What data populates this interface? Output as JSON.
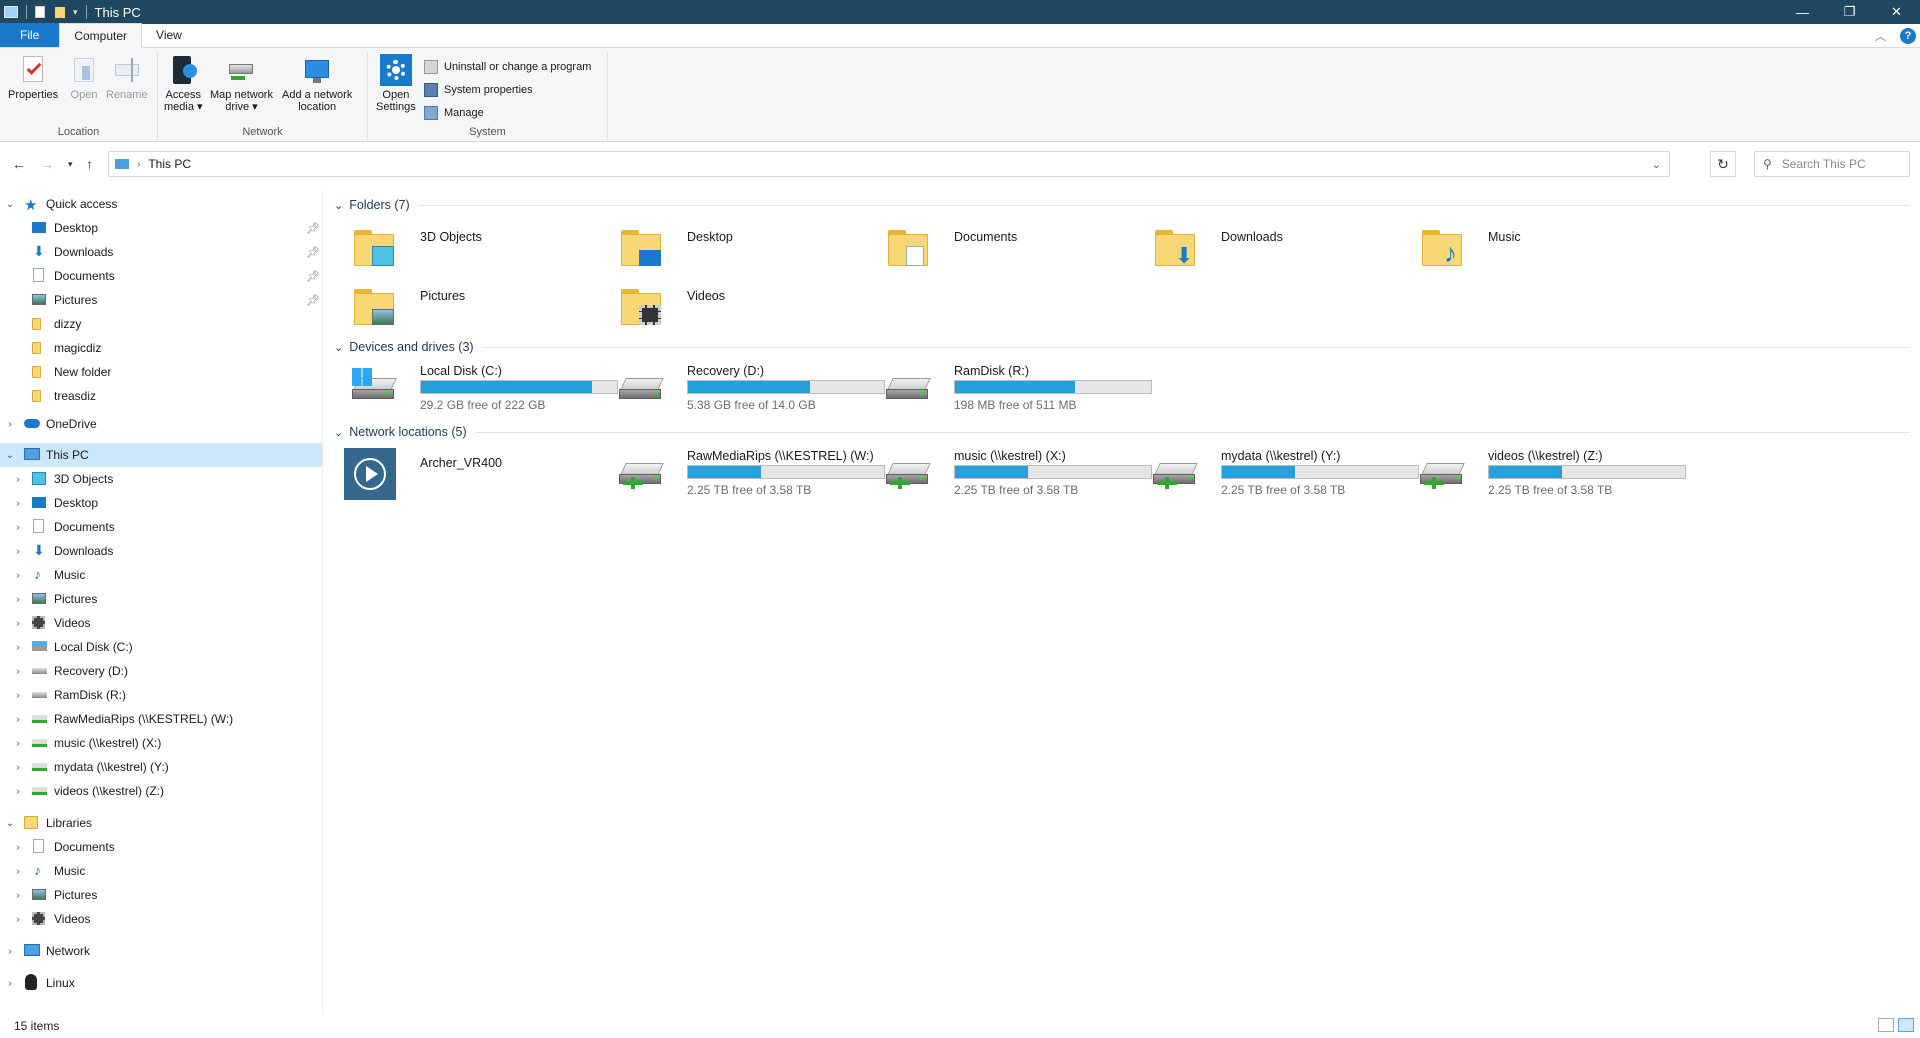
{
  "window": {
    "title": "This PC",
    "controls": {
      "minimize": "—",
      "maximize": "❐",
      "close": "✕"
    }
  },
  "ribbon": {
    "tabs": [
      {
        "label": "File"
      },
      {
        "label": "Computer"
      },
      {
        "label": "View"
      }
    ],
    "groups": {
      "location": {
        "label": "Location",
        "buttons": [
          {
            "label": "Properties"
          },
          {
            "label": "Open"
          },
          {
            "label": "Rename"
          }
        ]
      },
      "network": {
        "label": "Network",
        "buttons": [
          {
            "label1": "Access",
            "label2": "media"
          },
          {
            "label1": "Map network",
            "label2": "drive"
          },
          {
            "label1": "Add a network",
            "label2": "location"
          }
        ]
      },
      "system": {
        "label": "System",
        "open_settings": {
          "label1": "Open",
          "label2": "Settings"
        },
        "small_buttons": [
          {
            "label": "Uninstall or change a program"
          },
          {
            "label": "System properties"
          },
          {
            "label": "Manage"
          }
        ]
      }
    }
  },
  "address": {
    "path": "This PC",
    "search_placeholder": "Search This PC"
  },
  "nav": {
    "quick_access": {
      "label": "Quick access",
      "items": [
        {
          "label": "Desktop"
        },
        {
          "label": "Downloads"
        },
        {
          "label": "Documents"
        },
        {
          "label": "Pictures"
        },
        {
          "label": "dizzy"
        },
        {
          "label": "magicdiz"
        },
        {
          "label": "New folder"
        },
        {
          "label": "treasdiz"
        }
      ]
    },
    "onedrive": {
      "label": "OneDrive"
    },
    "this_pc": {
      "label": "This PC",
      "items": [
        {
          "label": "3D Objects"
        },
        {
          "label": "Desktop"
        },
        {
          "label": "Documents"
        },
        {
          "label": "Downloads"
        },
        {
          "label": "Music"
        },
        {
          "label": "Pictures"
        },
        {
          "label": "Videos"
        },
        {
          "label": "Local Disk (C:)"
        },
        {
          "label": "Recovery (D:)"
        },
        {
          "label": "RamDisk (R:)"
        },
        {
          "label": "RawMediaRips (\\\\KESTREL) (W:)"
        },
        {
          "label": "music (\\\\kestrel) (X:)"
        },
        {
          "label": "mydata (\\\\kestrel) (Y:)"
        },
        {
          "label": "videos (\\\\kestrel) (Z:)"
        }
      ]
    },
    "libraries": {
      "label": "Libraries",
      "items": [
        {
          "label": "Documents"
        },
        {
          "label": "Music"
        },
        {
          "label": "Pictures"
        },
        {
          "label": "Videos"
        }
      ]
    },
    "network": {
      "label": "Network"
    },
    "linux": {
      "label": "Linux"
    }
  },
  "content": {
    "folders": {
      "header": "Folders (7)",
      "items": [
        {
          "name": "3D Objects"
        },
        {
          "name": "Desktop"
        },
        {
          "name": "Documents"
        },
        {
          "name": "Downloads"
        },
        {
          "name": "Music"
        },
        {
          "name": "Pictures"
        },
        {
          "name": "Videos"
        }
      ]
    },
    "drives": {
      "header": "Devices and drives (3)",
      "items": [
        {
          "name": "Local Disk (C:)",
          "free": "29.2 GB free of 222 GB",
          "used_fraction": 0.87
        },
        {
          "name": "Recovery (D:)",
          "free": "5.38 GB free of 14.0 GB",
          "used_fraction": 0.62
        },
        {
          "name": "RamDisk (R:)",
          "free": "198 MB free of 511 MB",
          "used_fraction": 0.61
        }
      ]
    },
    "network": {
      "header": "Network locations (5)",
      "media": {
        "name": "Archer_VR400"
      },
      "items": [
        {
          "name": "RawMediaRips (\\\\KESTREL) (W:)",
          "free": "2.25 TB free of 3.58 TB",
          "used_fraction": 0.37
        },
        {
          "name": "music (\\\\kestrel) (X:)",
          "free": "2.25 TB free of 3.58 TB",
          "used_fraction": 0.37
        },
        {
          "name": "mydata (\\\\kestrel) (Y:)",
          "free": "2.25 TB free of 3.58 TB",
          "used_fraction": 0.37
        },
        {
          "name": "videos (\\\\kestrel) (Z:)",
          "free": "2.25 TB free of 3.58 TB",
          "used_fraction": 0.37
        }
      ]
    }
  },
  "status": {
    "count": "15 items"
  },
  "colors": {
    "titlebar": "#1f4860",
    "accent": "#1979ca",
    "bar_fill": "#26a0da",
    "selection": "#cce8ff"
  }
}
